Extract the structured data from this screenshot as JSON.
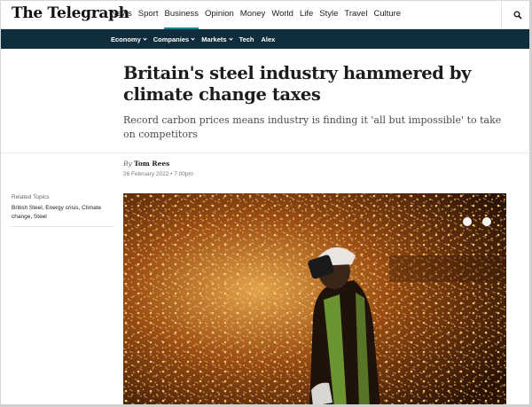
{
  "brand": {
    "logo_text": "The Telegraph"
  },
  "topnav": {
    "items": [
      "News",
      "Sport",
      "Business",
      "Opinion",
      "Money",
      "World",
      "Life",
      "Style",
      "Travel",
      "Culture"
    ],
    "active": "Business"
  },
  "subnav": {
    "items": [
      {
        "label": "Economy",
        "has_dropdown": true
      },
      {
        "label": "Companies",
        "has_dropdown": true
      },
      {
        "label": "Markets",
        "has_dropdown": true
      },
      {
        "label": "Tech",
        "has_dropdown": false
      },
      {
        "label": "Alex",
        "has_dropdown": false
      }
    ]
  },
  "article": {
    "headline": "Britain's steel industry hammered by climate change taxes",
    "standfirst": "Record carbon prices means industry is finding it 'all but impossible' to take on competitors",
    "by_prefix": "By",
    "author": "Tom Rees",
    "date": "26 February 2022 • 7:00pm"
  },
  "sidebar": {
    "related_title": "Related Topics",
    "related_links": "British Steel, Energy crisis, Climate change, Steel"
  },
  "hero": {
    "description_icon": "steelworker-sparks-photo"
  },
  "colors": {
    "accent": "#0b8a8f",
    "subnav_bg": "#0f2d3d"
  }
}
